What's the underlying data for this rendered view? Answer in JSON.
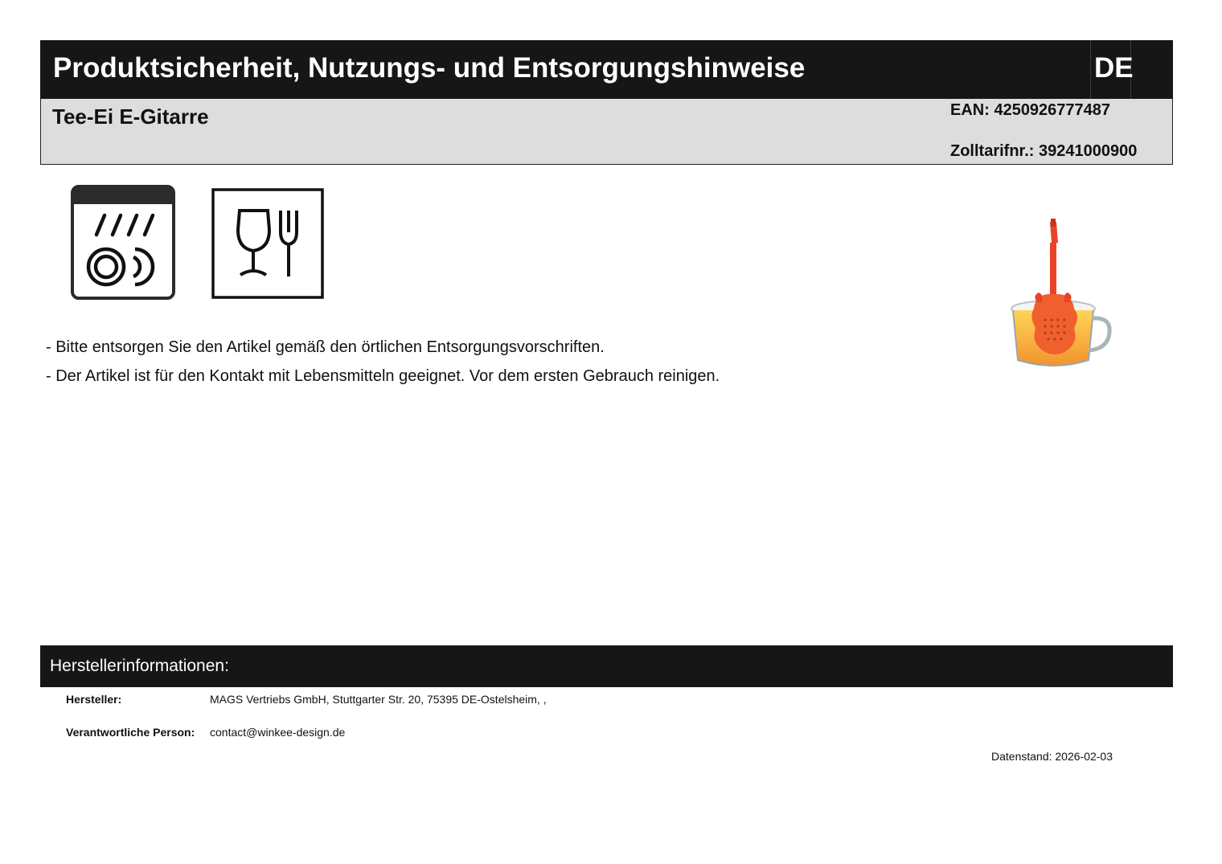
{
  "header": {
    "title": "Produktsicherheit, Nutzungs- und Entsorgungshinweise",
    "language": "DE"
  },
  "product": {
    "name": "Tee-Ei E-Gitarre",
    "ean": "EAN: 4250926777487",
    "tariff": "Zolltarifnr.: 39241000900"
  },
  "icons": [
    "dishwasher-safe-icon",
    "food-safe-icon"
  ],
  "notes": [
    "- Bitte entsorgen Sie den Artikel gemäß den örtlichen Entsorgungsvorschriften.",
    "- Der Artikel ist für den Kontakt mit Lebensmitteln geeignet.  Vor dem ersten Gebrauch reinigen."
  ],
  "manufacturer_section": {
    "title": "Herstellerinformationen:",
    "manufacturer_label": "Hersteller:",
    "manufacturer_value": "MAGS Vertriebs GmbH, Stuttgarter Str. 20, 75395 DE-Ostelsheim, ,",
    "responsible_label": "Verantwortliche Person:",
    "responsible_value": "contact@winkee-design.de"
  },
  "footer": {
    "date": "Datenstand: 2026-02-03"
  },
  "colors": {
    "header_bg": "#161616",
    "info_bg": "#dddddd",
    "product_red": "#e8432a",
    "tea_orange": "#f5a623"
  }
}
